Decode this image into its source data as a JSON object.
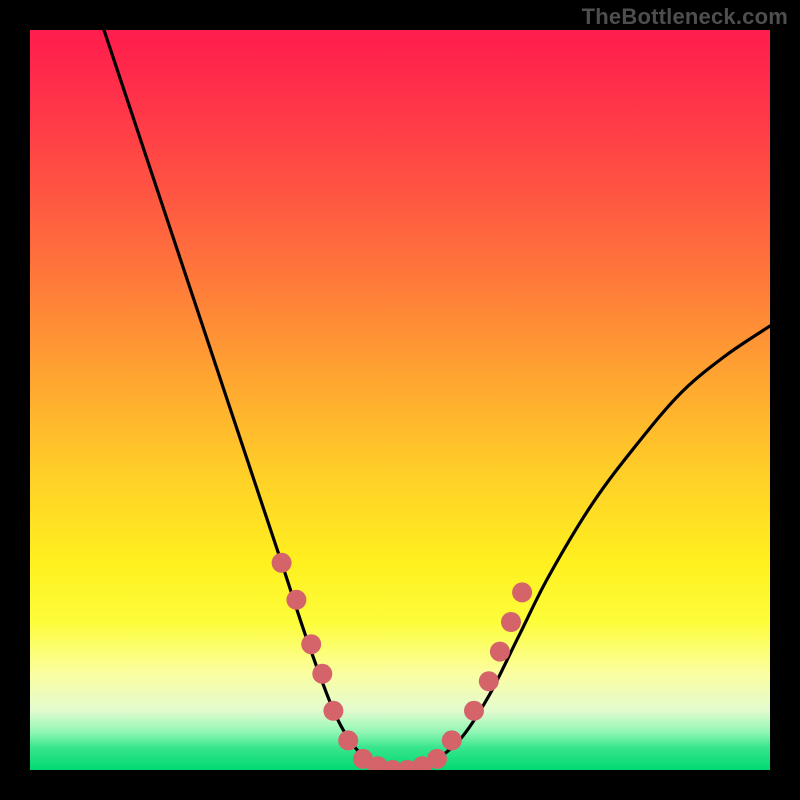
{
  "watermark": "TheBottleneck.com",
  "chart_data": {
    "type": "line",
    "title": "",
    "xlabel": "",
    "ylabel": "",
    "xlim": [
      0,
      100
    ],
    "ylim": [
      0,
      100
    ],
    "gradient_stops": [
      {
        "pct": 0,
        "color": "#ff1d4d"
      },
      {
        "pct": 8,
        "color": "#ff2f4a"
      },
      {
        "pct": 22,
        "color": "#ff5542"
      },
      {
        "pct": 34,
        "color": "#ff7a3a"
      },
      {
        "pct": 47,
        "color": "#ffa531"
      },
      {
        "pct": 60,
        "color": "#ffcf28"
      },
      {
        "pct": 72,
        "color": "#fff01f"
      },
      {
        "pct": 80,
        "color": "#fdfd3a"
      },
      {
        "pct": 87,
        "color": "#fbfea2"
      },
      {
        "pct": 92,
        "color": "#e3fbcf"
      },
      {
        "pct": 95,
        "color": "#8cf6b2"
      },
      {
        "pct": 97,
        "color": "#37e58d"
      },
      {
        "pct": 100,
        "color": "#00d973"
      }
    ],
    "series": [
      {
        "name": "bottleneck-curve",
        "x": [
          10,
          14,
          18,
          22,
          26,
          30,
          34,
          38,
          42,
          46,
          50,
          54,
          58,
          62,
          66,
          70,
          76,
          82,
          88,
          94,
          100
        ],
        "y": [
          100,
          88,
          76,
          64,
          52,
          40,
          28,
          16,
          6,
          1,
          0,
          1,
          4,
          10,
          18,
          26,
          36,
          44,
          51,
          56,
          60
        ]
      }
    ],
    "markers": {
      "name": "curve-dots",
      "color": "#d46469",
      "radius": 10,
      "points": [
        {
          "x": 34,
          "y": 28
        },
        {
          "x": 36,
          "y": 23
        },
        {
          "x": 38,
          "y": 17
        },
        {
          "x": 39.5,
          "y": 13
        },
        {
          "x": 41,
          "y": 8
        },
        {
          "x": 43,
          "y": 4
        },
        {
          "x": 45,
          "y": 1.5
        },
        {
          "x": 47,
          "y": 0.5
        },
        {
          "x": 49,
          "y": 0
        },
        {
          "x": 51,
          "y": 0
        },
        {
          "x": 53,
          "y": 0.5
        },
        {
          "x": 55,
          "y": 1.5
        },
        {
          "x": 57,
          "y": 4
        },
        {
          "x": 60,
          "y": 8
        },
        {
          "x": 62,
          "y": 12
        },
        {
          "x": 63.5,
          "y": 16
        },
        {
          "x": 65,
          "y": 20
        },
        {
          "x": 66.5,
          "y": 24
        }
      ]
    }
  }
}
